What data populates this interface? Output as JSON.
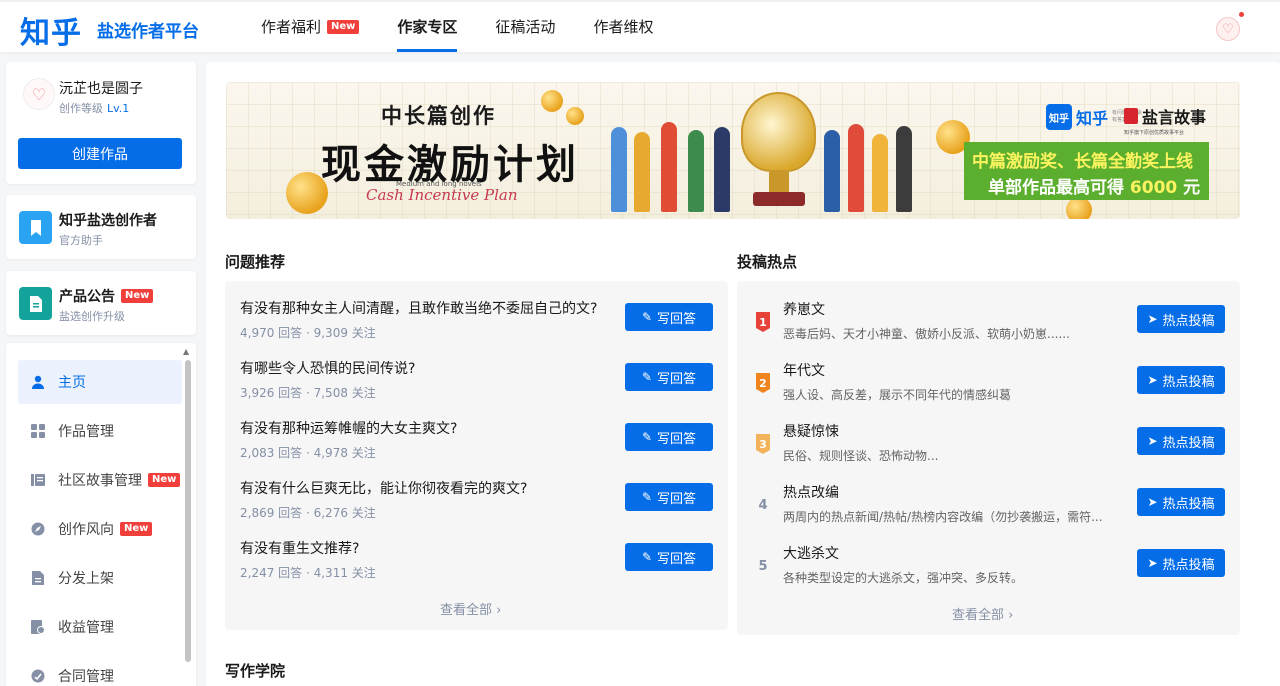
{
  "header": {
    "logo": "知乎",
    "platform": "盐选作者平台",
    "nav": [
      {
        "label": "作者福利",
        "badge": "New"
      },
      {
        "label": "作家专区",
        "badge": ""
      },
      {
        "label": "征稿活动",
        "badge": ""
      },
      {
        "label": "作者维权",
        "badge": ""
      }
    ],
    "active_nav": "作家专区"
  },
  "sidebar": {
    "user": {
      "name": "沅芷也是圆子",
      "level_label": "创作等级",
      "level": "Lv.1",
      "create_button": "创建作品"
    },
    "cards": [
      {
        "title": "知乎盐选创作者",
        "subtitle": "官方助手",
        "badge": "",
        "icon": "bookmark-icon"
      },
      {
        "title": "产品公告",
        "subtitle": "盐选创作升级",
        "badge": "New",
        "icon": "document-icon"
      }
    ],
    "menu": [
      {
        "label": "主页",
        "badge": "",
        "icon": "user-icon"
      },
      {
        "label": "作品管理",
        "badge": "",
        "icon": "grid-icon"
      },
      {
        "label": "社区故事管理",
        "badge": "New",
        "icon": "list-icon"
      },
      {
        "label": "创作风向",
        "badge": "New",
        "icon": "compass-icon"
      },
      {
        "label": "分发上架",
        "badge": "",
        "icon": "file-icon"
      },
      {
        "label": "收益管理",
        "badge": "",
        "icon": "wallet-icon"
      },
      {
        "label": "合同管理",
        "badge": "",
        "icon": "contract-icon"
      }
    ]
  },
  "banner": {
    "line1": "中长篇创作",
    "line2": "现金激励计划",
    "en_small": "Medium and long novels",
    "en_script": "Cash Incentive Plan",
    "zh_logo_square": "知乎",
    "zh_logo_text": "知乎",
    "zh_logo_small": "有问题，就会有答案",
    "yy_logo": "盐言故事",
    "yy_small": "知乎旗下原创优质故事平台",
    "promo1": "中篇激励奖、长篇全勤奖上线",
    "promo2_prefix": "单部作品最高可得",
    "promo2_amount": "6000",
    "promo2_suffix": "元"
  },
  "questions": {
    "title": "问题推荐",
    "button_label": "写回答",
    "see_all": "查看全部 ›",
    "items": [
      {
        "title": "有没有那种女主人间清醒，且敢作敢当绝不委屈自己的文?",
        "meta": "4,970 回答 · 9,309 关注"
      },
      {
        "title": "有哪些令人恐惧的民间传说?",
        "meta": "3,926 回答 · 7,508 关注"
      },
      {
        "title": "有没有那种运筹帷幄的大女主爽文?",
        "meta": "2,083 回答 · 4,978 关注"
      },
      {
        "title": "有没有什么巨爽无比，能让你彻夜看完的爽文?",
        "meta": "2,869 回答 · 6,276 关注"
      },
      {
        "title": "有没有重生文推荐?",
        "meta": "2,247 回答 · 4,311 关注"
      }
    ]
  },
  "hot": {
    "title": "投稿热点",
    "button_label": "热点投稿",
    "see_all": "查看全部 ›",
    "items": [
      {
        "rank": "1",
        "title": "养崽文",
        "desc": "恶毒后妈、天才小神童、傲娇小反派、软萌小奶崽......"
      },
      {
        "rank": "2",
        "title": "年代文",
        "desc": "强人设、高反差，展示不同年代的情感纠葛"
      },
      {
        "rank": "3",
        "title": "悬疑惊悚",
        "desc": "民俗、规则怪谈、恐怖动物..."
      },
      {
        "rank": "4",
        "title": "热点改编",
        "desc": "两周内的热点新闻/热帖/热榜内容改编（勿抄袭搬运，需符..."
      },
      {
        "rank": "5",
        "title": "大逃杀文",
        "desc": "各种类型设定的大逃杀文，强冲突、多反转。"
      }
    ]
  },
  "academy": {
    "title": "写作学院"
  }
}
